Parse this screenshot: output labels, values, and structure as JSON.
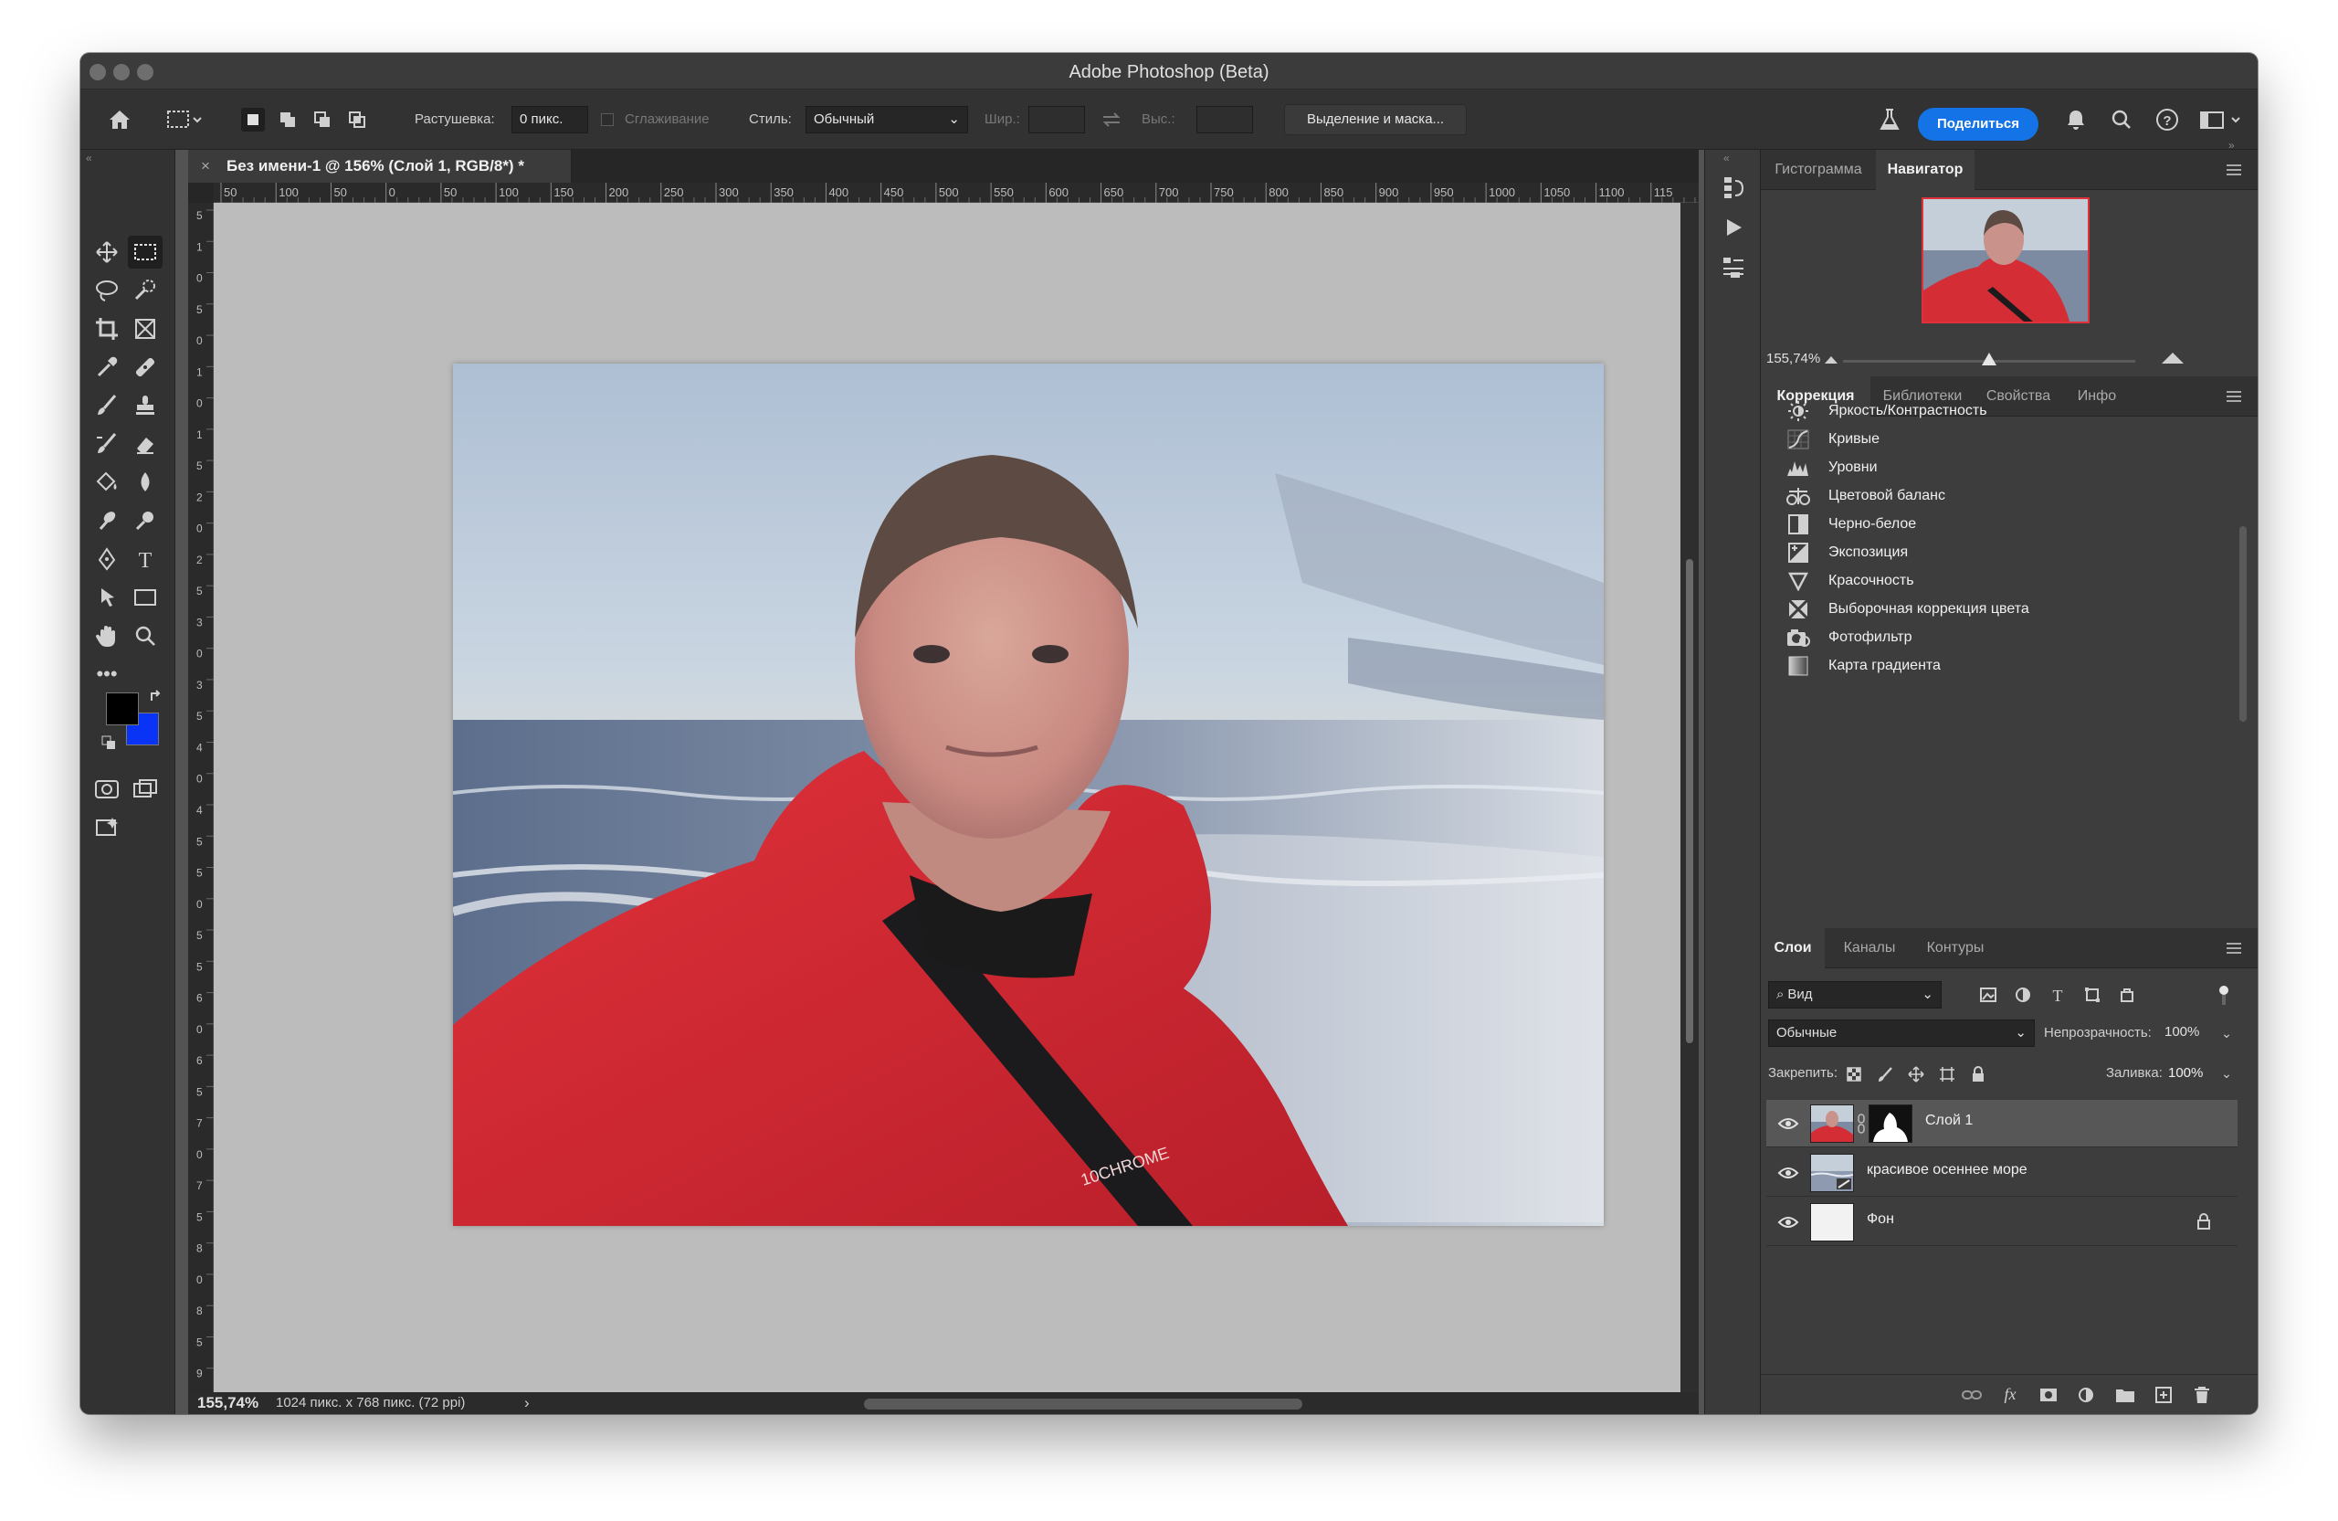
{
  "window": {
    "title": "Adobe Photoshop (Beta)"
  },
  "options_bar": {
    "feather_label": "Растушевка:",
    "feather_value": "0 пикс.",
    "antialias_label": "Сглаживание",
    "style_label": "Стиль:",
    "style_value": "Обычный",
    "width_label": "Шир.:",
    "height_label": "Выс.:",
    "select_mask_button": "Выделение и маска...",
    "share_button": "Поделиться"
  },
  "document": {
    "tab_title": "Без имени-1 @ 156% (Слой 1, RGB/8*) *",
    "zoom": "155,74%",
    "doc_info": "1024 пикс. x 768 пикс. (72 ppi)",
    "ruler_h": [
      "50",
      "100",
      "50",
      "0",
      "50",
      "100",
      "150",
      "200",
      "250",
      "300",
      "350",
      "400",
      "450",
      "500",
      "550",
      "600",
      "650",
      "700",
      "750",
      "800",
      "850",
      "900",
      "950",
      "1000",
      "1050",
      "1100",
      "115"
    ],
    "ruler_v": [
      "5",
      "1",
      "0",
      "5",
      "0",
      "1",
      "0",
      "1",
      "5",
      "2",
      "0",
      "2",
      "5",
      "3",
      "0",
      "3",
      "5",
      "4",
      "0",
      "4",
      "5",
      "5",
      "0",
      "5",
      "5",
      "6",
      "0",
      "6",
      "5",
      "7",
      "0",
      "7",
      "5",
      "8",
      "0",
      "8",
      "5",
      "9"
    ]
  },
  "navigator": {
    "tabs": [
      "Гистограмма",
      "Навигатор"
    ],
    "active_tab": "Навигатор",
    "zoom": "155,74%",
    "zoom_fraction": 0.5
  },
  "adjustments": {
    "tabs": [
      "Коррекция",
      "Библиотеки",
      "Свойства",
      "Инфо"
    ],
    "active_tab": "Коррекция",
    "items": [
      {
        "label": "Яркость/Контрастность",
        "icon": "brightness-icon"
      },
      {
        "label": "Кривые",
        "icon": "curves-icon"
      },
      {
        "label": "Уровни",
        "icon": "levels-icon"
      },
      {
        "label": "Цветовой баланс",
        "icon": "color-balance-icon"
      },
      {
        "label": "Черно-белое",
        "icon": "black-white-icon"
      },
      {
        "label": "Экспозиция",
        "icon": "exposure-icon"
      },
      {
        "label": "Красочность",
        "icon": "vibrance-icon"
      },
      {
        "label": "Выборочная коррекция цвета",
        "icon": "selective-color-icon"
      },
      {
        "label": "Фотофильтр",
        "icon": "photo-filter-icon"
      },
      {
        "label": "Карта градиента",
        "icon": "gradient-map-icon"
      }
    ]
  },
  "layers_panel": {
    "tabs": [
      "Слои",
      "Каналы",
      "Контуры"
    ],
    "active_tab": "Слои",
    "filter_value": "Вид",
    "blend_mode": "Обычные",
    "opacity_label": "Непрозрачность:",
    "opacity_value": "100%",
    "lock_label": "Закрепить:",
    "fill_label": "Заливка:",
    "fill_value": "100%",
    "layers": [
      {
        "name": "Слой 1",
        "selected": true
      },
      {
        "name": "красивое осеннее море",
        "selected": false
      },
      {
        "name": "Фон",
        "selected": false,
        "locked": true
      }
    ]
  },
  "colors": {
    "foreground": "#000000",
    "background": "#0a34f5",
    "accent": "#1473e6"
  }
}
